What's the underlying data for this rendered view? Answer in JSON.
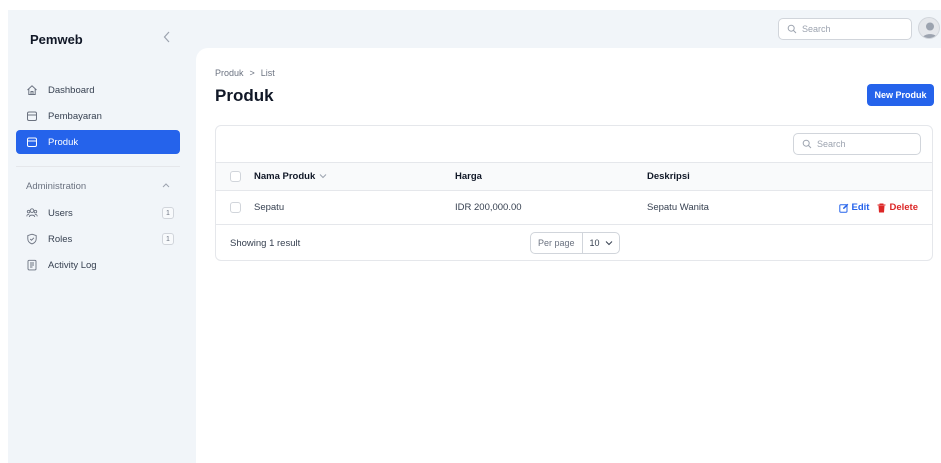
{
  "app": {
    "brand": "Pemweb"
  },
  "colors": {
    "accent": "#2563eb",
    "danger": "#dc2626"
  },
  "sidebar": {
    "items": [
      {
        "label": "Dashboard",
        "icon": "home-icon",
        "active": false
      },
      {
        "label": "Pembayaran",
        "icon": "archive-icon",
        "active": false
      },
      {
        "label": "Produk",
        "icon": "archive-icon",
        "active": true
      }
    ],
    "group": {
      "label": "Administration",
      "items": [
        {
          "label": "Users",
          "icon": "users-icon",
          "badge": "1"
        },
        {
          "label": "Roles",
          "icon": "shield-icon",
          "badge": "1"
        },
        {
          "label": "Activity Log",
          "icon": "log-icon",
          "badge": ""
        }
      ]
    }
  },
  "topbar": {
    "search_placeholder": "Search"
  },
  "page": {
    "breadcrumb": [
      "Produk",
      ">",
      "List"
    ],
    "title": "Produk",
    "new_button": "New Produk"
  },
  "table": {
    "search_placeholder": "Search",
    "columns": [
      "Nama Produk",
      "Harga",
      "Deskripsi"
    ],
    "rows": [
      {
        "nama": "Sepatu",
        "harga": "IDR 200,000.00",
        "deskripsi": "Sepatu Wanita"
      }
    ],
    "actions": {
      "edit": "Edit",
      "delete": "Delete"
    },
    "footer": {
      "showing": "Showing 1 result",
      "per_page_label": "Per page",
      "per_page_value": "10"
    }
  }
}
